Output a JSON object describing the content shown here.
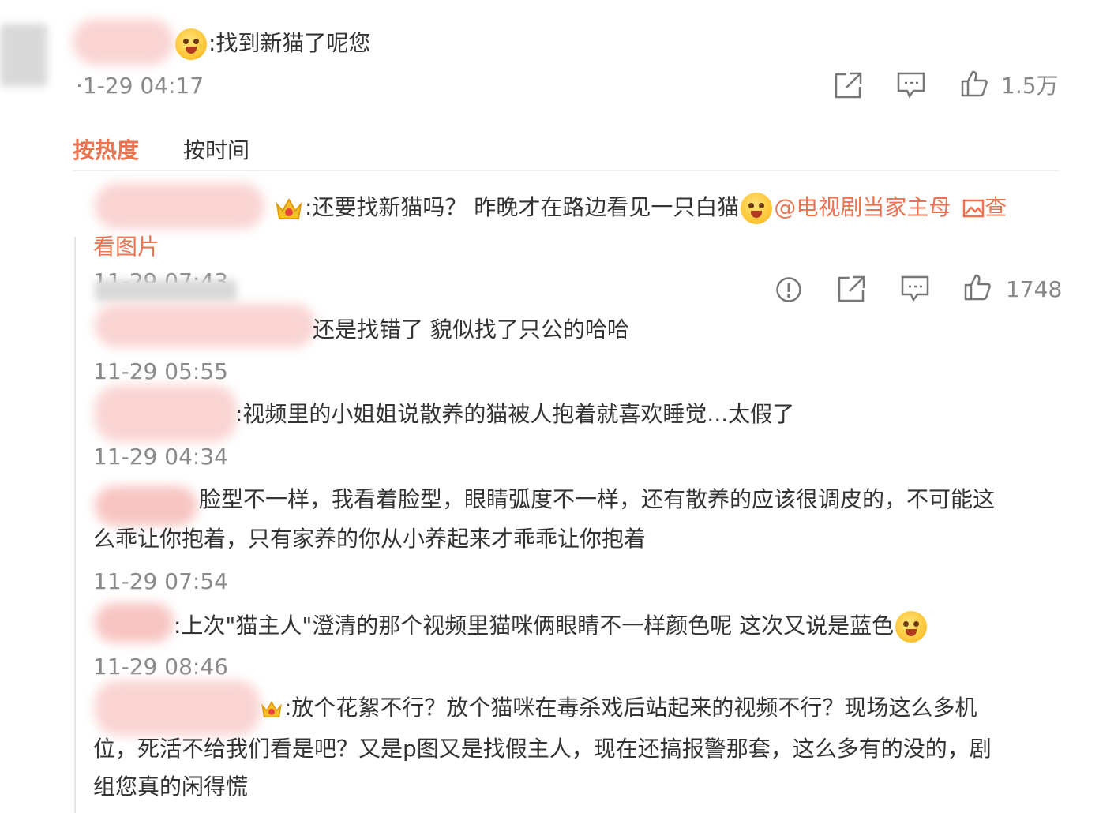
{
  "post": {
    "text": ":找到新猫了呢您",
    "time": "·1-29 04:17",
    "like_count": "1.5万"
  },
  "sort_tabs": {
    "hot": "按热度",
    "time": "按时间"
  },
  "top_comment": {
    "text_before_emoji": ":还要找新猫吗？ 昨晚才在路边看见一只白猫",
    "mention": "@电视剧当家主母",
    "view_image_a": "查",
    "view_image_b": "看图片",
    "time_partial": "11-29 07:43",
    "like_count": "1748"
  },
  "replies": [
    {
      "text": "还是找错了 貌似找了只公的哈哈",
      "time": "11-29 05:55"
    },
    {
      "text": ":视频里的小姐姐说散养的猫被人抱着就喜欢睡觉...太假了",
      "time": "11-29 04:34"
    },
    {
      "text_line1": "脸型不一样，我看着脸型，眼睛弧度不一样，还有散养的应该很调皮的，不可能这",
      "text_line2": "么乖让你抱着，只有家养的你从小养起来才乖乖让你抱着",
      "time": "11-29 07:54"
    },
    {
      "text": ":上次\"猫主人\"澄清的那个视频里猫咪俩眼睛不一样颜色呢 这次又说是蓝色",
      "time": "11-29 08:46"
    },
    {
      "text_line1": ":放个花絮不行？放个猫咪在毒杀戏后站起来的视频不行？现场这么多机",
      "text_line2": "位，死活不给我们看是吧？又是p图又是找假主人，现在还搞报警那套，这么多有的没的，剧",
      "text_line3": "组您真的闲得慌"
    }
  ],
  "colors": {
    "accent": "#eb7350",
    "text": "#333333",
    "meta": "#8a8a8a"
  },
  "icons": [
    "share-icon",
    "comment-icon",
    "like-icon",
    "report-icon",
    "smile-emoji-icon",
    "crown-badge-icon",
    "image-icon"
  ]
}
